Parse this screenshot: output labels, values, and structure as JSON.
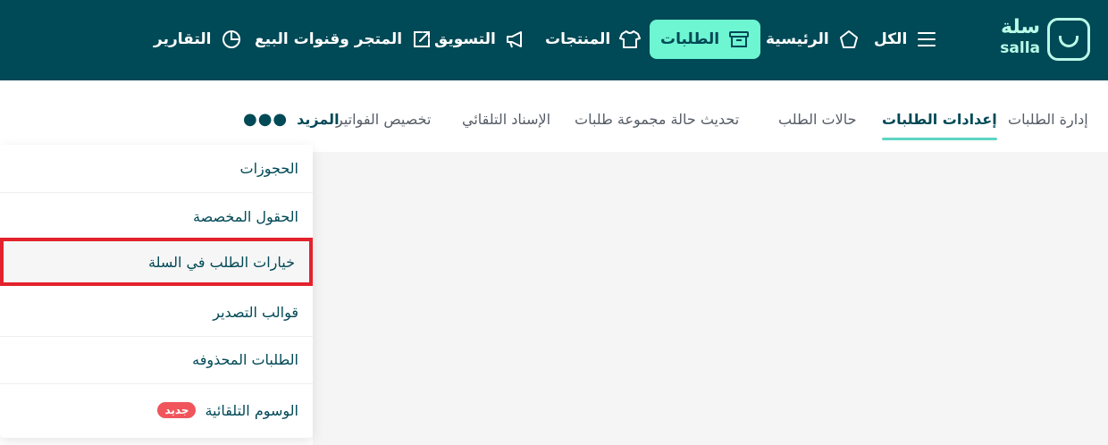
{
  "brand": {
    "name_ar": "سلة",
    "name_en": "salla"
  },
  "nav": {
    "all": "الكل",
    "home": "الرئيسية",
    "orders": "الطلبات",
    "products": "المنتجات",
    "marketing": "التسويق",
    "store_channels": "المتجر وقنوات البيع",
    "reports": "التقارير"
  },
  "tabs": {
    "manage_orders": "إدارة الطلبات",
    "order_settings": "إعدادات الطلبات",
    "order_statuses": "حالات الطلب",
    "bulk_status_update": "تحديث حالة مجموعة طلبات",
    "auto_assign": "الإسناد التلقائي",
    "invoice_customization": "تخصيص الفواتير",
    "more": "المزيد"
  },
  "dropdown": {
    "items": [
      {
        "label": "الحجوزات"
      },
      {
        "label": "الحقول المخصصة"
      },
      {
        "label": "خيارات الطلب في السلة"
      },
      {
        "label": "قوالب التصدير"
      },
      {
        "label": "الطلبات المحذوفه"
      },
      {
        "label": "الوسوم التلقائية",
        "badge": "جديد"
      }
    ]
  },
  "colors": {
    "topbar": "#004956",
    "accent": "#6ef5d1",
    "highlight_border": "#e2222d",
    "badge": "#f0555b"
  }
}
